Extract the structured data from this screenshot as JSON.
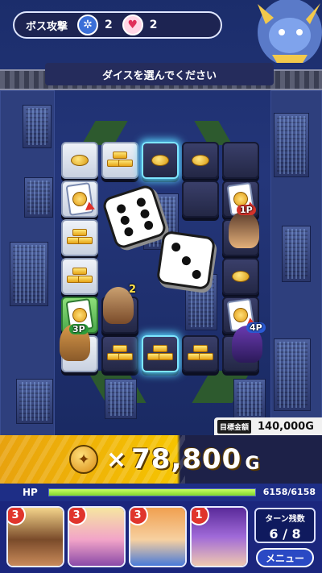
{
  "top_bar": {
    "label": "ボス攻撃",
    "gear_count": "2",
    "heart_count": "2"
  },
  "banner": {
    "text": "ダイスを選んでください"
  },
  "board": {
    "badges": {
      "player_a": "2",
      "player_b": "1P",
      "player_c": "3P",
      "player_d": "4P"
    },
    "dice_values": [
      6,
      3
    ]
  },
  "target": {
    "label": "目標金額",
    "value": "140,000G"
  },
  "score": {
    "times": "×",
    "amount": "78,800",
    "unit": "G"
  },
  "hp": {
    "label": "HP",
    "current": 6158,
    "max": 6158,
    "text": "6158/6158"
  },
  "party": {
    "members": [
      {
        "count": "3"
      },
      {
        "count": "3"
      },
      {
        "count": "3"
      },
      {
        "count": "1"
      }
    ],
    "turn_label": "ターン残数",
    "turn_value": "6 / 8",
    "menu_label": "メニュー"
  },
  "colors": {
    "accent_gold": "#f6c400",
    "hp_green": "#9fe64a",
    "badge_red": "#e0352c"
  }
}
